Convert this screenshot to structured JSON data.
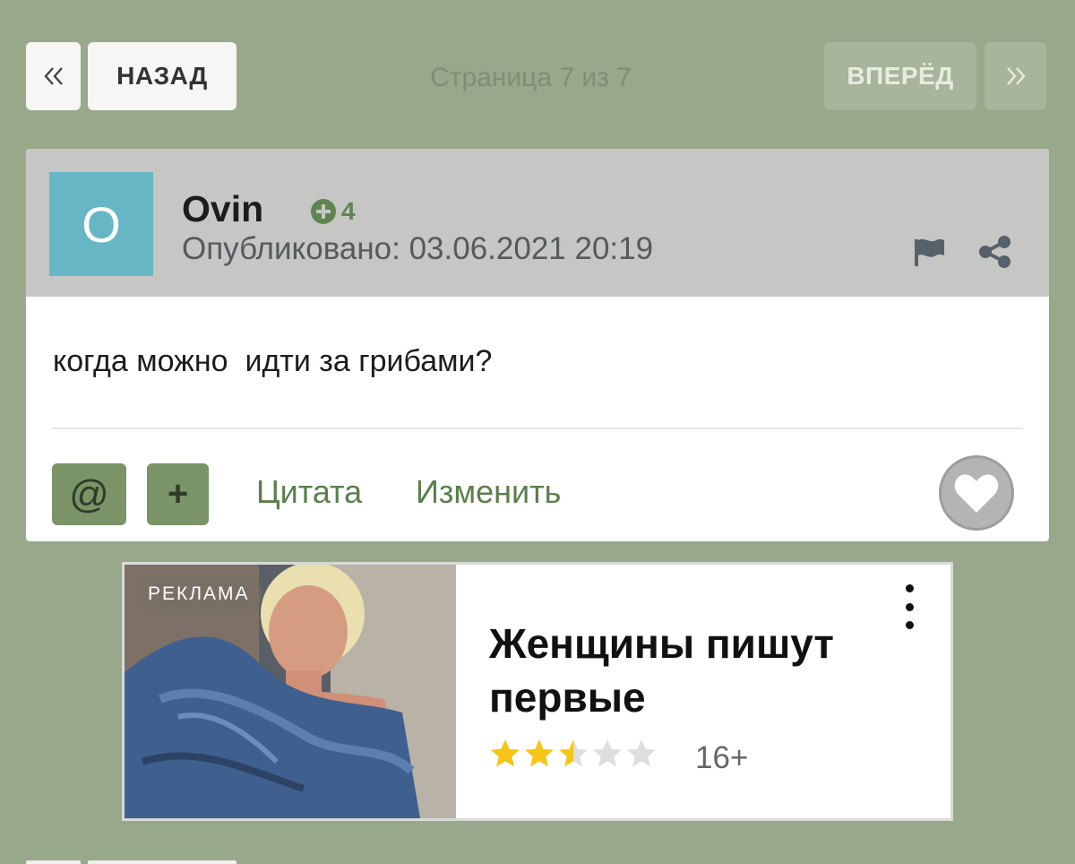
{
  "pagination": {
    "prev_label": "НАЗАД",
    "next_label": "ВПЕРЁД",
    "page_info": "Страница 7 из 7"
  },
  "post": {
    "avatar_letter": "O",
    "author": "Ovin",
    "reputation": "4",
    "published": "Опубликовано: 03.06.2021 20:19",
    "text": "когда можно  идти за грибами?",
    "actions": {
      "mention": "@",
      "plus": "+",
      "quote": "Цитата",
      "edit": "Изменить"
    }
  },
  "ad": {
    "badge": "РЕКЛАМА",
    "title": "Женщины пишут первые",
    "rating": 2.5,
    "rating_max": 5,
    "age": "16+"
  },
  "colors": {
    "background": "#97a98a",
    "accent": "#5b7f4c",
    "avatar": "#67b6c6",
    "star": "#f5c518"
  }
}
